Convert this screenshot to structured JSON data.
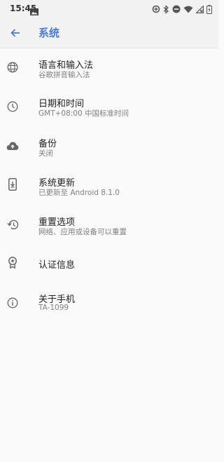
{
  "status_bar": {
    "time": "15:45"
  },
  "header": {
    "title": "系统"
  },
  "settings": [
    {
      "icon": "globe-icon",
      "title": "语言和输入法",
      "subtitle": "谷歌拼音输入法"
    },
    {
      "icon": "clock-icon",
      "title": "日期和时间",
      "subtitle": "GMT+08:00 中国标准时间"
    },
    {
      "icon": "cloud-upload-icon",
      "title": "备份",
      "subtitle": "关闭"
    },
    {
      "icon": "system-update-icon",
      "title": "系统更新",
      "subtitle": "已更新至 Android 8.1.0"
    },
    {
      "icon": "restore-icon",
      "title": "重置选项",
      "subtitle": "网络、应用或设备可以重置"
    },
    {
      "icon": "certificate-icon",
      "title": "认证信息",
      "subtitle": ""
    },
    {
      "icon": "info-icon",
      "title": "关于手机",
      "subtitle": "TA-1099"
    }
  ],
  "colors": {
    "accent": "#4a7bd8",
    "background": "#fafafa",
    "bar": "#f2f2f2"
  }
}
